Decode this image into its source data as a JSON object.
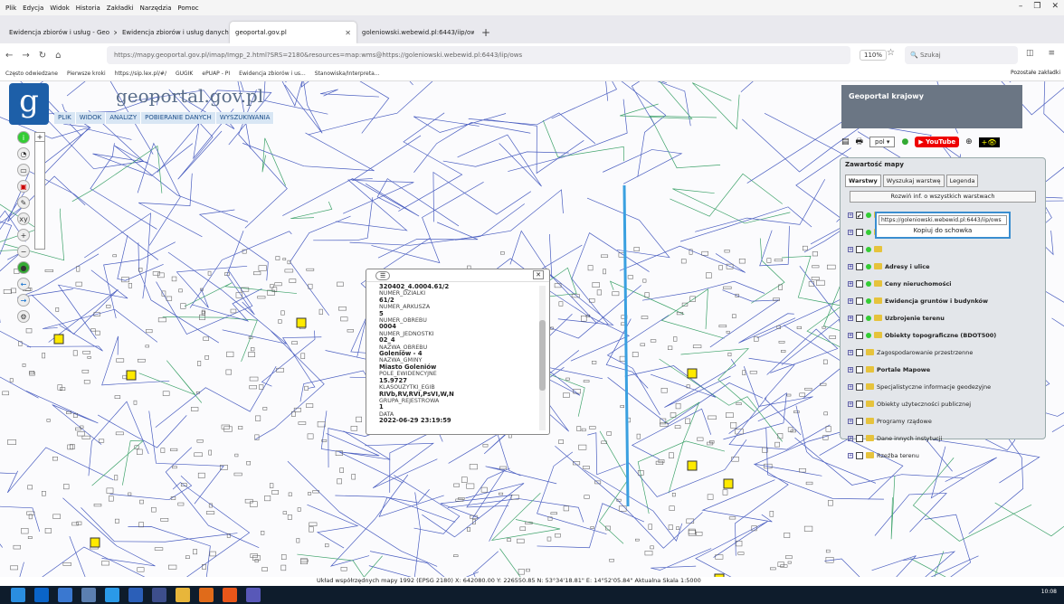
{
  "menubar": {
    "items": [
      "Plik",
      "Edycja",
      "Widok",
      "Historia",
      "Zakładki",
      "Narzędzia",
      "Pomoc"
    ]
  },
  "tabs": [
    {
      "label": "Ewidencja zbiorów i usług - Geo",
      "active": false
    },
    {
      "label": "Ewidencja zbiorów i usług danych p",
      "active": false
    },
    {
      "label": "geoportal.gov.pl",
      "active": true
    },
    {
      "label": "goleniowski.webewid.pl:6443/iip/ow",
      "active": false
    }
  ],
  "navbar": {
    "url": "https://mapy.geoportal.gov.pl/imap/Imgp_2.html?SRS=2180&resources=map:wms@https://goleniowski.webewid.pl:6443/iip/ows",
    "zoom": "110%",
    "search_placeholder": "Szukaj"
  },
  "bookmarks": {
    "items": [
      "Często odwiedzane",
      "Pierwsze kroki",
      "https://sip.lex.pl/#/",
      "GUGIK",
      "ePUAP - PI",
      "Ewidencja zbiorów i us...",
      "Stanowiska/Interpreta..."
    ],
    "right": "Pozostałe zakładki"
  },
  "site": {
    "name": "geoportal.gov.pl",
    "menu": [
      "PLIK",
      "WIDOK",
      "ANALIZY",
      "POBIERANIE DANYCH",
      "WYSZUKIWANIA"
    ]
  },
  "gk": {
    "title": "Geoportal krajowy",
    "lang": "pol",
    "youtube": "YouTube"
  },
  "panel": {
    "title": "Zawartość mapy",
    "tabs": [
      "Warstwy",
      "Wyszukaj warstwę",
      "Legenda"
    ],
    "expand": "Rozwiń inf. o wszystkich warstwach",
    "layers": [
      {
        "label": "",
        "checked": true
      },
      {
        "label": "",
        "checked": false
      },
      {
        "label": "",
        "checked": false
      },
      {
        "label": "Adresy i ulice",
        "bold": true
      },
      {
        "label": "Ceny nieruchomości",
        "bold": true
      },
      {
        "label": "Ewidencja gruntów i budynków",
        "bold": true
      },
      {
        "label": "Uzbrojenie terenu",
        "bold": true
      },
      {
        "label": "Obiekty topograficzne (BDOT500)",
        "bold": true
      },
      {
        "label": "Zagospodarowanie przestrzenne",
        "bold": false
      },
      {
        "label": "Portale Mapowe",
        "bold": true
      },
      {
        "label": "Specjalistyczne informacje geodezyjne",
        "bold": false
      },
      {
        "label": "Obiekty użyteczności publicznej",
        "bold": false
      },
      {
        "label": "Programy rządowe",
        "bold": false
      },
      {
        "label": "Dane innych instytucji",
        "bold": false
      },
      {
        "label": "Rzeźba terenu",
        "bold": false
      }
    ]
  },
  "tooltip": {
    "url": "https://goleniowski.webewid.pl:6443/iip/ows",
    "copy": "Kopiuj do schowka"
  },
  "info": {
    "title": "320402_4.0004.61/2",
    "rows": [
      {
        "k": "NUMER_DZIALKI",
        "v": "61/2"
      },
      {
        "k": "NUMER_ARKUSZA",
        "v": "5"
      },
      {
        "k": "NUMER_OBREBU",
        "v": "0004"
      },
      {
        "k": "NUMER_JEDNOSTKI",
        "v": "02_4"
      },
      {
        "k": "NAZWA_OBREBU",
        "v": "Goleniów - 4"
      },
      {
        "k": "NAZWA_GMINY",
        "v": "Miasto Goleniów"
      },
      {
        "k": "POLE_EWIDENCYJNE",
        "v": "15.9727"
      },
      {
        "k": "KLASOUZYTKI_EGIB",
        "v": "RIVb,RV,RVI,PsVI,W,N"
      },
      {
        "k": "GRUPA_REJESTROWA",
        "v": "1"
      },
      {
        "k": "DATA",
        "v": "2022-06-29 23:19:59"
      }
    ]
  },
  "status": {
    "text": "Układ współrzędnych mapy 1992 (EPSG 2180)  X: 642080.00 Y: 226550.85  N: 53°34'18.81\" E: 14°52'05.84\"  Aktualna Skala 1:5000"
  },
  "clock": {
    "time": "10:08"
  }
}
